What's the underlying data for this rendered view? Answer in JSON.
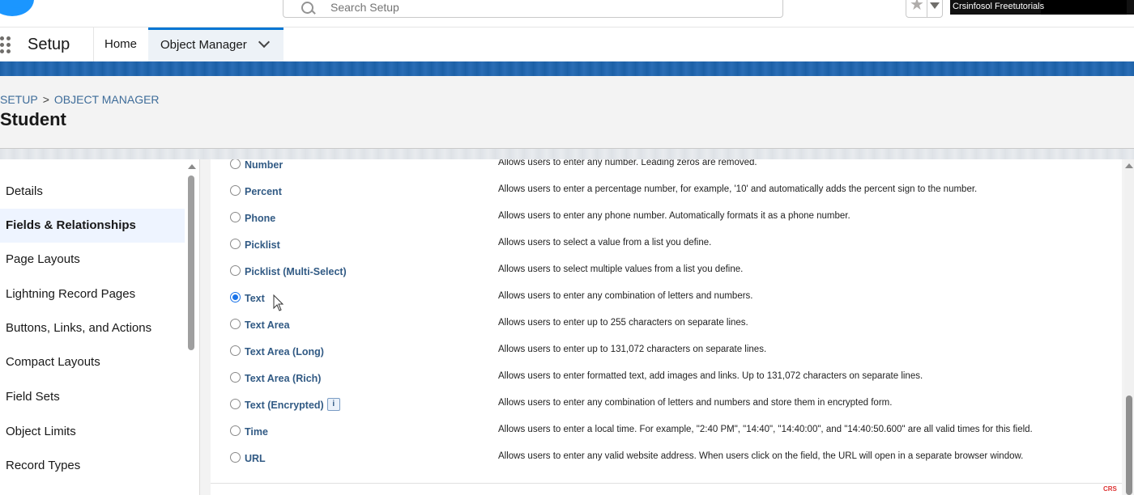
{
  "search": {
    "placeholder": "Search Setup"
  },
  "video_banner": {
    "text": "Crsinfosol Freetutorials"
  },
  "nav": {
    "app_title": "Setup",
    "tabs": [
      {
        "label": "Home"
      },
      {
        "label": "Object Manager"
      }
    ]
  },
  "header": {
    "breadcrumb": [
      "SETUP",
      "OBJECT MANAGER"
    ],
    "breadcrumb_separator": ">",
    "title": "Student"
  },
  "sidebar": {
    "items": [
      {
        "label": "Details",
        "active": false
      },
      {
        "label": "Fields & Relationships",
        "active": true
      },
      {
        "label": "Page Layouts",
        "active": false
      },
      {
        "label": "Lightning Record Pages",
        "active": false
      },
      {
        "label": "Buttons, Links, and Actions",
        "active": false
      },
      {
        "label": "Compact Layouts",
        "active": false
      },
      {
        "label": "Field Sets",
        "active": false
      },
      {
        "label": "Object Limits",
        "active": false
      },
      {
        "label": "Record Types",
        "active": false
      }
    ]
  },
  "field_types": [
    {
      "label": "Number",
      "checked": false,
      "description": "Allows users to enter any number. Leading zeros are removed."
    },
    {
      "label": "Percent",
      "checked": false,
      "description": "Allows users to enter a percentage number, for example, '10' and automatically adds the percent sign to the number."
    },
    {
      "label": "Phone",
      "checked": false,
      "description": "Allows users to enter any phone number. Automatically formats it as a phone number."
    },
    {
      "label": "Picklist",
      "checked": false,
      "description": "Allows users to select a value from a list you define."
    },
    {
      "label": "Picklist (Multi-Select)",
      "checked": false,
      "description": "Allows users to select multiple values from a list you define."
    },
    {
      "label": "Text",
      "checked": true,
      "description": "Allows users to enter any combination of letters and numbers."
    },
    {
      "label": "Text Area",
      "checked": false,
      "description": "Allows users to enter up to 255 characters on separate lines."
    },
    {
      "label": "Text Area (Long)",
      "checked": false,
      "description": "Allows users to enter up to 131,072 characters on separate lines."
    },
    {
      "label": "Text Area (Rich)",
      "checked": false,
      "description": "Allows users to enter formatted text, add images and links. Up to 131,072 characters on separate lines."
    },
    {
      "label": "Text (Encrypted)",
      "checked": false,
      "has_info": true,
      "info_icon": "i",
      "description": "Allows users to enter any combination of letters and numbers and store them in encrypted form."
    },
    {
      "label": "Time",
      "checked": false,
      "description": "Allows users to enter a local time. For example, \"2:40 PM\", \"14:40\", \"14:40:00\", and \"14:40:50.600\" are all valid times for this field."
    },
    {
      "label": "URL",
      "checked": false,
      "description": "Allows users to enter any valid website address. When users click on the field, the URL will open in a separate browser window."
    }
  ],
  "watermark": {
    "text": "CRS"
  },
  "colors": {
    "accent": "#0176d3",
    "brand_band": "#1b5fa6",
    "label_blue": "#315a84",
    "breadcrumb": "#3e6c99"
  }
}
